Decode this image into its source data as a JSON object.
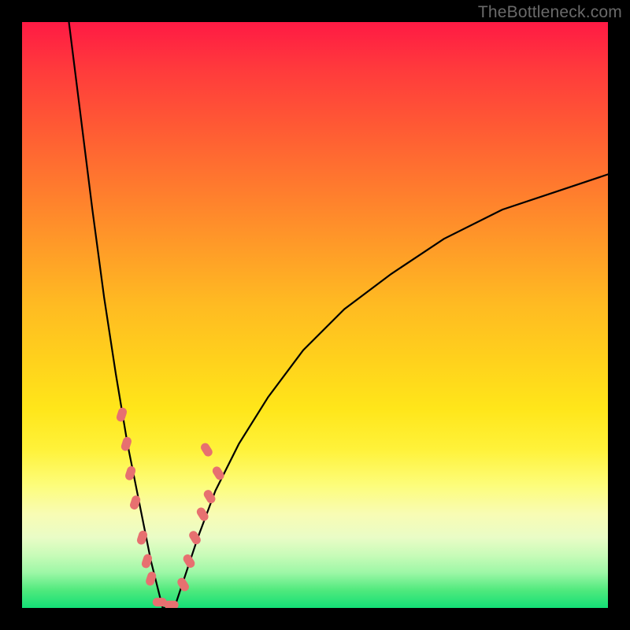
{
  "watermark": "TheBottleneck.com",
  "colors": {
    "frame": "#000000",
    "curve": "#000000",
    "marker": "#e77070",
    "gradient_top": "#ff1a44",
    "gradient_bottom": "#13df76"
  },
  "chart_data": {
    "type": "line",
    "title": "",
    "xlabel": "",
    "ylabel": "",
    "xlim": [
      0,
      100
    ],
    "ylim": [
      0,
      100
    ],
    "note": "Axes are unlabeled in the image; values are estimated in percent of plot area (x left→right, y bottom→top). The curve is a V-shaped bottleneck curve with its minimum near x≈24 touching y≈0, a steep left arm rising to y≈100 at x≈8, and a shallower right arm rising to y≈74 at x=100.",
    "series": [
      {
        "name": "bottleneck-curve",
        "x": [
          8,
          10,
          12,
          14,
          16,
          18,
          20,
          22,
          24,
          26,
          28,
          30,
          33,
          37,
          42,
          48,
          55,
          63,
          72,
          82,
          91,
          100
        ],
        "y": [
          100,
          84,
          68,
          53,
          40,
          28,
          18,
          8,
          0,
          0,
          6,
          12,
          20,
          28,
          36,
          44,
          51,
          57,
          63,
          68,
          71,
          74
        ]
      }
    ],
    "markers": {
      "name": "highlighted-points",
      "note": "Pink rounded markers clustered along both arms of the V near the bottom.",
      "points": [
        {
          "x": 17.0,
          "y": 33
        },
        {
          "x": 17.8,
          "y": 28
        },
        {
          "x": 18.5,
          "y": 23
        },
        {
          "x": 19.3,
          "y": 18
        },
        {
          "x": 20.5,
          "y": 12
        },
        {
          "x": 21.3,
          "y": 8
        },
        {
          "x": 22.0,
          "y": 5
        },
        {
          "x": 23.5,
          "y": 1
        },
        {
          "x": 25.5,
          "y": 0.5
        },
        {
          "x": 27.5,
          "y": 4
        },
        {
          "x": 28.5,
          "y": 8
        },
        {
          "x": 29.5,
          "y": 12
        },
        {
          "x": 30.8,
          "y": 16
        },
        {
          "x": 32.0,
          "y": 19
        },
        {
          "x": 33.5,
          "y": 23
        },
        {
          "x": 31.5,
          "y": 27
        }
      ]
    },
    "background_gradient": {
      "orientation": "vertical",
      "stops": [
        {
          "pos": 0.0,
          "color": "#ff1a44"
        },
        {
          "pos": 0.38,
          "color": "#ff9a28"
        },
        {
          "pos": 0.66,
          "color": "#ffe61a"
        },
        {
          "pos": 0.84,
          "color": "#f8fcb4"
        },
        {
          "pos": 1.0,
          "color": "#13df76"
        }
      ]
    }
  }
}
